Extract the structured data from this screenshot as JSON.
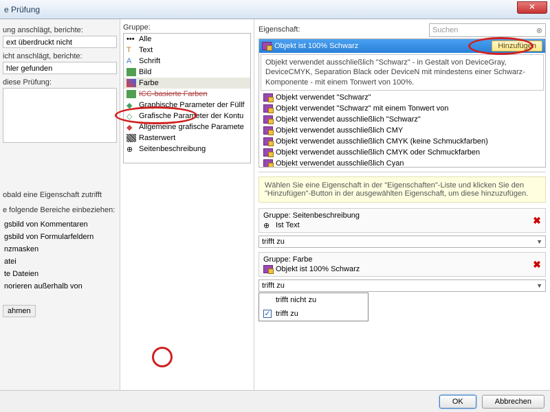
{
  "window": {
    "title": "e Prüfung"
  },
  "left": {
    "l1": "ung anschlägt, berichte:",
    "b1": "ext überdruckt nicht",
    "l2": "icht anschlägt, berichte:",
    "b2": "hler gefunden",
    "l3": "diese Prüfung:",
    "hit": "obald eine Eigenschaft zutrifft",
    "areas": "e folgende Bereiche einbeziehen:",
    "items": [
      "gsbild von Kommentaren",
      "gsbild von Formularfeldern",
      "nzmasken",
      "atei",
      "te Dateien",
      "norieren außerhalb von"
    ],
    "tray": "ahmen"
  },
  "groups": {
    "label": "Gruppe:",
    "items": [
      {
        "t": "Alle"
      },
      {
        "t": "Text"
      },
      {
        "t": "Schrift"
      },
      {
        "t": "Bild"
      },
      {
        "t": "Farbe",
        "sel": true
      },
      {
        "t": "ICC-basierte Farben",
        "strike": true
      },
      {
        "t": "Graphische Parameter der Füllf"
      },
      {
        "t": "Grafische Parameter der Kontu"
      },
      {
        "t": "Allgemeine grafische Paramete"
      },
      {
        "t": "Rasterwert"
      },
      {
        "t": "Seitenbeschreibung"
      }
    ]
  },
  "props": {
    "label": "Eigenschaft:",
    "searchPlaceholder": "Suchen",
    "selected": "Objekt ist 100% Schwarz",
    "add": "Hinzufügen",
    "desc": "Objekt verwendet ausschließlich \"Schwarz\" - in Gestalt von DeviceGray, DeviceCMYK, Separation Black oder DeviceN mit mindestens einer Schwarz-Komponente - mit einem Tonwert von 100%.",
    "rows": [
      "Objekt verwendet \"Schwarz\"",
      "Objekt verwendet \"Schwarz\" mit einem Tonwert von",
      "Objekt verwendet ausschließlich \"Schwarz\"",
      "Objekt verwendet ausschließlich CMY",
      "Objekt verwendet ausschließlich CMYK (keine Schmuckfarben)",
      "Objekt verwendet ausschließlich CMYK oder Schmuckfarben",
      "Objekt verwendet ausschließlich Cyan"
    ]
  },
  "lower": {
    "hint": "Wählen Sie eine Eigenschaft in der \"Eigenschaften\"-Liste und klicken Sie den \"Hinzufügen\"-Button in der ausgewählten Eigenschaft, um diese hinzuzufügen.",
    "c1g": "Gruppe:  Seitenbeschreibung",
    "c1p": "Ist Text",
    "c1m": "trifft zu",
    "c2g": "Gruppe:  Farbe",
    "c2p": "Objekt ist 100% Schwarz",
    "c2m": "trifft zu",
    "opt1": "trifft nicht zu",
    "opt2": "trifft zu"
  },
  "footer": {
    "ok": "OK",
    "cancel": "Abbrechen"
  }
}
